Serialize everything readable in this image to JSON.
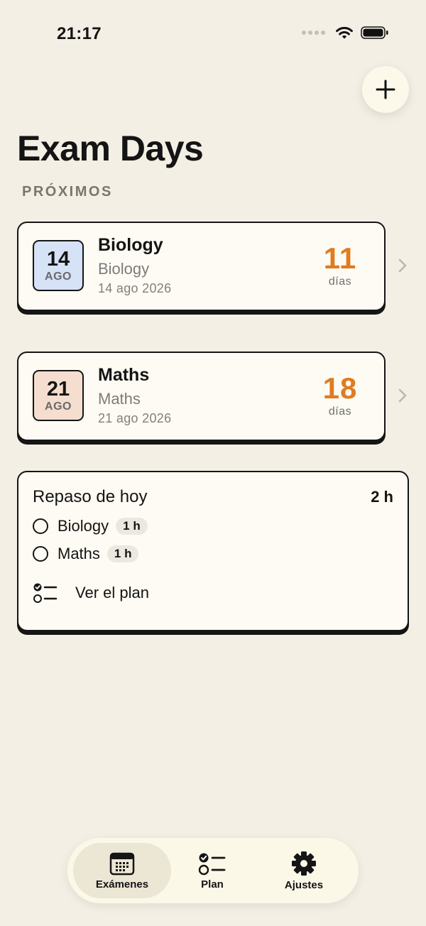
{
  "status_bar": {
    "time": "21:17"
  },
  "header": {
    "title": "Exam Days",
    "section_label": "PRÓXIMOS"
  },
  "exams": [
    {
      "day": "14",
      "month": "AGO",
      "name": "Biology",
      "subject": "Biology",
      "date": "14 ago 2026",
      "days_left": "11",
      "days_unit": "días",
      "badge_color": "#d6e2f6"
    },
    {
      "day": "21",
      "month": "AGO",
      "name": "Maths",
      "subject": "Maths",
      "date": "21 ago 2026",
      "days_left": "18",
      "days_unit": "días",
      "badge_color": "#f5ddd0"
    }
  ],
  "review": {
    "title": "Repaso de hoy",
    "total": "2 h",
    "tasks": [
      {
        "label": "Biology",
        "duration": "1 h"
      },
      {
        "label": "Maths",
        "duration": "1 h"
      }
    ],
    "plan_link": "Ver el plan"
  },
  "tabs": [
    {
      "label": "Exámenes",
      "icon": "calendar-icon",
      "active": true
    },
    {
      "label": "Plan",
      "icon": "checklist-icon",
      "active": false
    },
    {
      "label": "Ajustes",
      "icon": "gear-icon",
      "active": false
    }
  ],
  "colors": {
    "accent": "#e07b20",
    "background": "#f3efe5",
    "card": "#fdfbf3",
    "border": "#151515"
  }
}
